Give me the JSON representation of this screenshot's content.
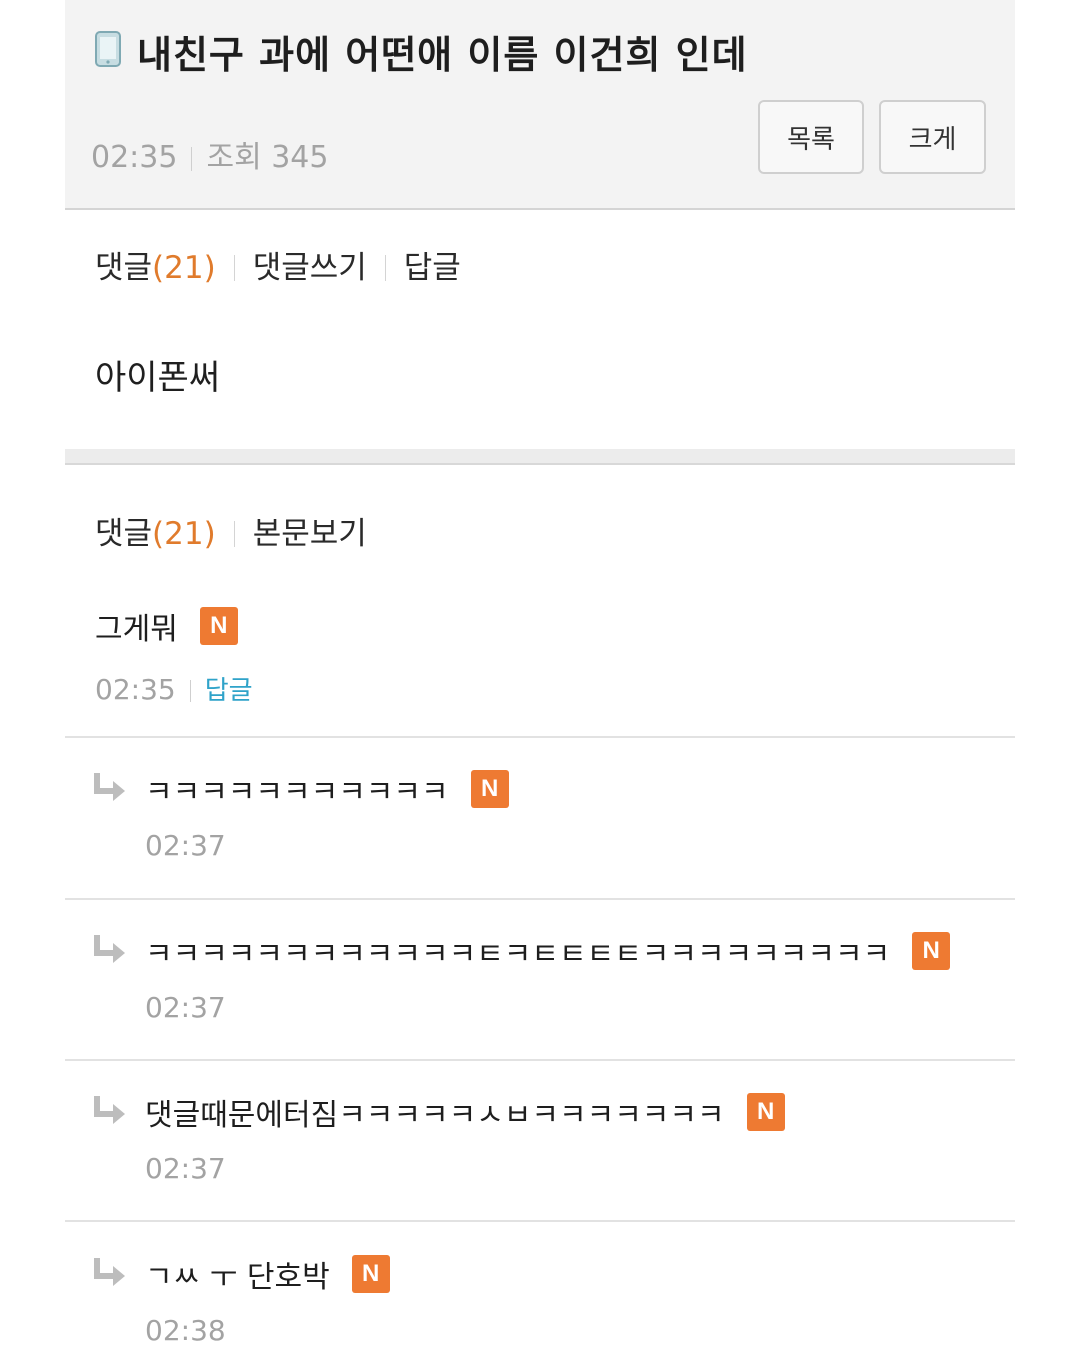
{
  "post": {
    "title": "내친구 과에 어떤애 이름 이건희 인데",
    "time": "02:35",
    "views_label": "조회 345",
    "list_button": "목록",
    "big_button": "크게",
    "body": "아이폰써"
  },
  "tabs_top": {
    "comments": "댓글",
    "count": "(21)",
    "write": "댓글쓰기",
    "reply": "답글"
  },
  "tabs_bottom": {
    "comments": "댓글",
    "count": "(21)",
    "view_body": "본문보기"
  },
  "badge": "N",
  "comments": [
    {
      "text": "그게뭐",
      "time": "02:35",
      "reply_link": "답글"
    }
  ],
  "replies": [
    {
      "text": "ㅋㅋㅋㅋㅋㅋㅋㅋㅋㅋㅋ",
      "time": "02:37"
    },
    {
      "text": "ㅋㅋㅋㅋㅋㅋㅋㅋㅋㅋㅋㅋㅌㅋㅌㅌㅌㅌㅋㅋㅋㅋㅋㅋㅋㅋㅋ",
      "time": "02:37"
    },
    {
      "text": "댓글때문에터짐ㅋㅋㅋㅋㅋㅅㅂㅋㅋㅋㅋㅋㅋㅋ",
      "time": "02:37"
    },
    {
      "text": "ㄱㅆ ㅜ 단호박",
      "time": "02:38"
    }
  ],
  "colors": {
    "accent_orange": "#ee7a32",
    "reply_link": "#2fa3c9",
    "header_bg": "#f3f3f3"
  }
}
